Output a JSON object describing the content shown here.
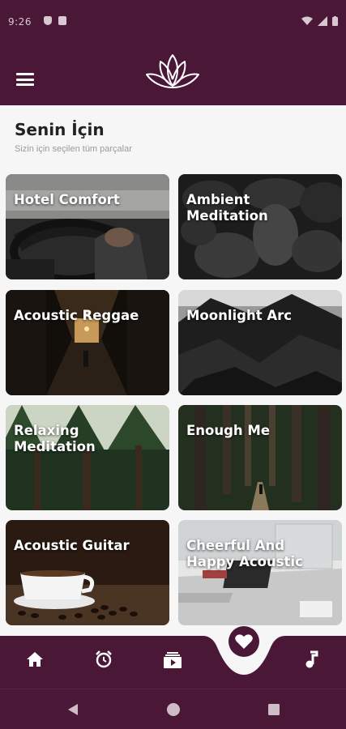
{
  "status_bar": {
    "time": "9:26"
  },
  "section": {
    "title": "Senin İçin",
    "subtitle": "Sizin için seçilen tüm parçalar"
  },
  "tracks": [
    {
      "title": "Hotel Comfort"
    },
    {
      "title": "Ambient Meditation"
    },
    {
      "title": "Acoustic Reggae"
    },
    {
      "title": "Moonlight Arc"
    },
    {
      "title": "Relaxing Meditation"
    },
    {
      "title": "Enough Me"
    },
    {
      "title": "Acoustic Guitar"
    },
    {
      "title": "Cheerful And Happy Acoustic"
    }
  ],
  "nav": {
    "items": [
      "home-icon",
      "alarm-icon",
      "playlist-icon",
      "heart-icon",
      "music-note-icon"
    ],
    "active": "heart-icon"
  },
  "colors": {
    "primary": "#4a1736",
    "background": "#f6f6f6",
    "card_text": "#ffffff"
  }
}
